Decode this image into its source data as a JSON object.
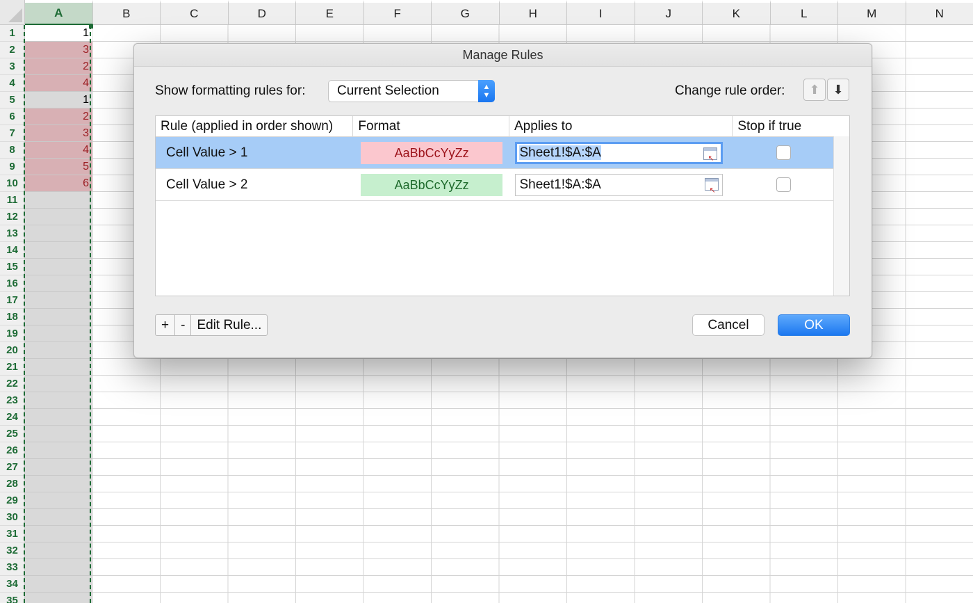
{
  "spreadsheet": {
    "columns": [
      "A",
      "B",
      "C",
      "D",
      "E",
      "F",
      "G",
      "H",
      "I",
      "J",
      "K",
      "L",
      "M",
      "N"
    ],
    "rows": [
      "1",
      "2",
      "3",
      "4",
      "5",
      "6",
      "7",
      "8",
      "9",
      "10",
      "11",
      "12",
      "13",
      "14",
      "15",
      "16",
      "17",
      "18",
      "19",
      "20",
      "21",
      "22",
      "23",
      "24",
      "25",
      "26",
      "27",
      "28",
      "29",
      "30",
      "31",
      "32",
      "33",
      "34",
      "35"
    ],
    "column_a": [
      {
        "value": "1",
        "highlight": false
      },
      {
        "value": "3",
        "highlight": true
      },
      {
        "value": "2",
        "highlight": true
      },
      {
        "value": "4",
        "highlight": true
      },
      {
        "value": "1",
        "highlight": false
      },
      {
        "value": "2",
        "highlight": true
      },
      {
        "value": "3",
        "highlight": true
      },
      {
        "value": "4",
        "highlight": true
      },
      {
        "value": "5",
        "highlight": true
      },
      {
        "value": "6",
        "highlight": true
      }
    ]
  },
  "dialog": {
    "title": "Manage Rules",
    "show_rules_label": "Show formatting rules for:",
    "scope_value": "Current Selection",
    "change_order_label": "Change rule order:",
    "headers": {
      "rule": "Rule (applied in order shown)",
      "format": "Format",
      "applies_to": "Applies to",
      "stop_if_true": "Stop if true"
    },
    "rules": [
      {
        "rule": "Cell Value > 1",
        "format_sample": "AaBbCcYyZz",
        "applies_to": "Sheet1!$A:$A"
      },
      {
        "rule": "Cell Value > 2",
        "format_sample": "AaBbCcYyZz",
        "applies_to": "Sheet1!$A:$A"
      }
    ],
    "add_label": "+",
    "remove_label": "-",
    "edit_label": "Edit Rule...",
    "cancel_label": "Cancel",
    "ok_label": "OK"
  },
  "colors": {
    "accent": "#1c78f0",
    "excel_green": "#1d6b35",
    "rule1_fill": "#fbc7ce",
    "rule1_text": "#9c1119",
    "rule2_fill": "#c6efce",
    "rule2_text": "#1d6a2b",
    "selected_row": "#a6ccf7"
  },
  "icons": [
    "triangle-corner-icon",
    "popup-arrows-icon",
    "arrow-up-icon",
    "arrow-down-icon",
    "range-reference-icon",
    "range-reference-icon"
  ]
}
